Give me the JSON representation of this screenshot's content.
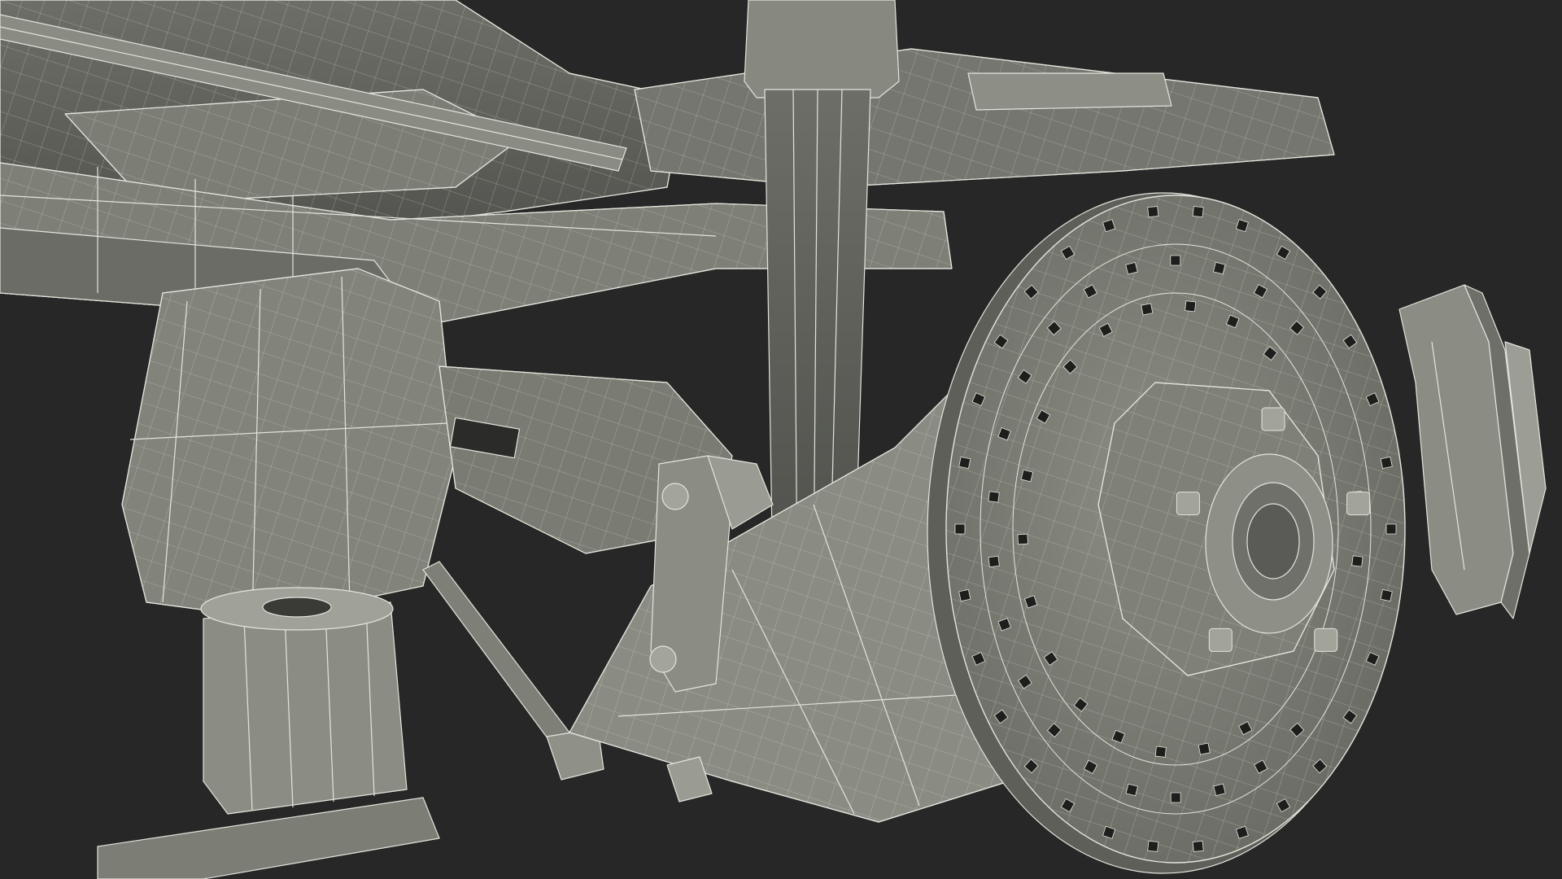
{
  "scene": {
    "subject": "wireframe-3d-render",
    "colors": {
      "background": "#272727",
      "surface_light": "#8a8b82",
      "surface_mid": "#6f7069",
      "surface_dark": "#565752",
      "wire": "#e4e4dc",
      "hole": "#1e1f1d"
    }
  }
}
